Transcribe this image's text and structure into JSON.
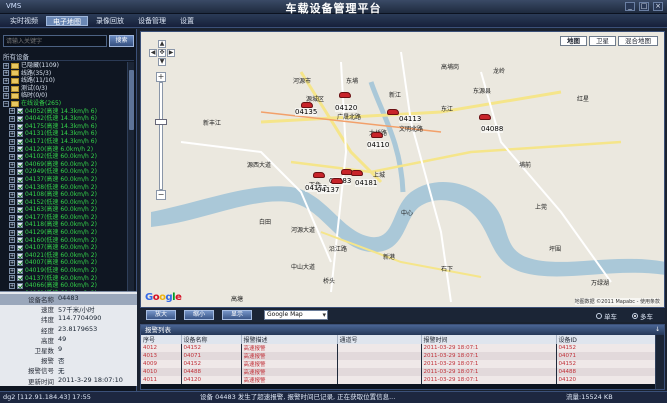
{
  "window": {
    "app_name": "VMS",
    "title": "车载设备管理平台",
    "buttons": [
      "_",
      "□",
      "×"
    ]
  },
  "menu": {
    "tabs": [
      {
        "label": "实时视频",
        "active": false
      },
      {
        "label": "电子地图",
        "active": true
      },
      {
        "label": "录像回放",
        "active": false
      },
      {
        "label": "设备管理",
        "active": false
      },
      {
        "label": "设置",
        "active": false
      }
    ]
  },
  "left_panel": {
    "search_placeholder": "请输入关键字",
    "search_button": "搜索",
    "tree_header": "所有设备",
    "groups": [
      {
        "label": "已隐藏(1109)",
        "expanded": false
      },
      {
        "label": "线路(35/3)",
        "expanded": false
      },
      {
        "label": "线路(11/10)",
        "expanded": false
      },
      {
        "label": "测试(0/3)",
        "expanded": false
      },
      {
        "label": "临时(0/0)",
        "expanded": false
      },
      {
        "label": "在线设备(265)",
        "expanded": true
      }
    ],
    "devices": [
      "04052(高速 14.3km/h 6)",
      "04042(低速 14.3km/h 6)",
      "04175(高速 14.3km/h 6)",
      "04131(低速 14.3km/h 6)",
      "04171(低速 14.3km/h 6)",
      "04120(高速 6.0km/h 2)",
      "04102(低速 60.0km/h 2)",
      "04069(高速 60.0km/h 2)",
      "02949(低速 60.0km/h 2)",
      "04137(高速 60.0km/h 2)",
      "04138(低速 60.0km/h 2)",
      "04108(高速 60.0km/h 2)",
      "04152(低速 60.0km/h 2)",
      "04163(高速 60.0km/h 2)",
      "04177(低速 60.0km/h 2)",
      "04118(高速 60.0km/h 2)",
      "04129(高速 60.0km/h 2)",
      "04160(低速 60.0km/h 2)",
      "04107(高速 60.0km/h 2)",
      "04021(低速 60.0km/h 2)",
      "04007(高速 60.0km/h 2)",
      "04019(低速 60.0km/h 2)",
      "04137(低速 60.0km/h 2)",
      "04066(高速 60.0km/h 2)",
      "04061(低速 60.0km/h 2)"
    ]
  },
  "info_panel": {
    "rows": [
      {
        "key": "设备名称",
        "value": "04483",
        "highlight": true
      },
      {
        "key": "速度",
        "value": "57千米/小时",
        "highlight": false
      },
      {
        "key": "纬度",
        "value": "114.7704090",
        "highlight": false
      },
      {
        "key": "经度",
        "value": "23.8179653",
        "highlight": false
      },
      {
        "key": "高度",
        "value": "49",
        "highlight": false
      },
      {
        "key": "卫星数",
        "value": "9",
        "highlight": false
      },
      {
        "key": "报警",
        "value": "否",
        "highlight": false
      },
      {
        "key": "报警信号",
        "value": "无",
        "highlight": false
      },
      {
        "key": "更新时间",
        "value": "2011-3-29 18:07:10",
        "highlight": false
      }
    ]
  },
  "map": {
    "type_buttons": [
      "地图",
      "卫星",
      "混合地图"
    ],
    "nav_icons": [
      "▲",
      "◀",
      "▶",
      "▼",
      "✥"
    ],
    "zoom_in": "+",
    "zoom_out": "−",
    "zoom_level_fraction": 0.66,
    "logo_letters": [
      "G",
      "o",
      "o",
      "g",
      "l",
      "e"
    ],
    "logo_colors": [
      "#3369e8",
      "#d50f25",
      "#eeb211",
      "#3369e8",
      "#009925",
      "#d50f25"
    ],
    "copyright": "地图数据 ©2011 Mapabc - 使用条款",
    "place_labels": [
      "河源市",
      "东埔",
      "源城区",
      "新江",
      "广晟北路",
      "大桥路",
      "文明北路",
      "东江",
      "新丰江",
      "源西大道",
      "上城",
      "下角",
      "埔前",
      "高埔岗",
      "龙岭",
      "白田",
      "河源大道",
      "沿江路",
      "中山大道",
      "新港",
      "桥头",
      "石下",
      "坪围",
      "东源县",
      "红星",
      "中心",
      "上莞",
      "高塘",
      "万绿湖"
    ],
    "device_labels": [
      "04135",
      "04120",
      "04110",
      "04113",
      "04088",
      "04152",
      "04483",
      "04181",
      "04137"
    ],
    "car_color": "#c8242a"
  },
  "map_toolbar": {
    "buttons": [
      "放大",
      "缩小",
      "显示"
    ],
    "map_source": "Google Map",
    "radio_options": [
      {
        "label": "单车",
        "selected": false
      },
      {
        "label": "多车",
        "selected": true
      }
    ]
  },
  "alarm_list": {
    "title": "报警列表",
    "pin": "↓",
    "columns": [
      "序号",
      "设备名称",
      "报警描述",
      "通道号",
      "报警时间",
      "设备ID"
    ],
    "rows": [
      [
        "4012",
        "04152",
        "高速报警",
        "",
        "2011-03-29 18:07:1",
        "04152"
      ],
      [
        "4013",
        "04071",
        "高速报警",
        "",
        "2011-03-29 18:07:1",
        "04071"
      ],
      [
        "4009",
        "04152",
        "高速报警",
        "",
        "2011-03-29 18:07:1",
        "04152"
      ],
      [
        "4010",
        "04488",
        "高速报警",
        "",
        "2011-03-29 18:07:1",
        "04488"
      ],
      [
        "4011",
        "04120",
        "高速报警",
        "",
        "2011-03-29 18:07:1",
        "04120"
      ]
    ]
  },
  "status_bar": {
    "left": "dg2 [112.91.184.43] 17:55",
    "center": "设备 04483 发生了超速报警, 报警时间已记录, 正在获取位置信息...",
    "right": "流量:15524 KB"
  },
  "colors": {
    "accent": "#6b88b5",
    "online": "#34d44a",
    "alarm_text": "#c03038",
    "water": "#aac8d8",
    "road": "#f5e58a"
  }
}
